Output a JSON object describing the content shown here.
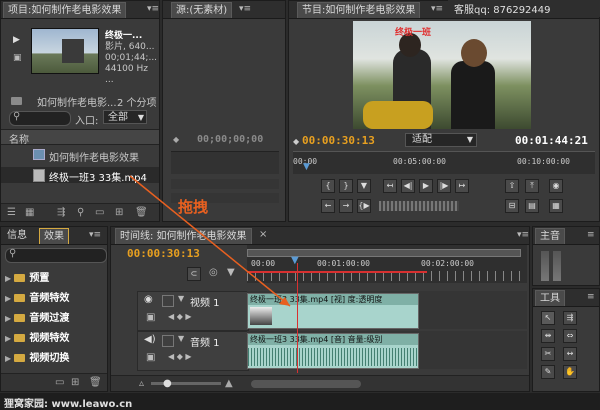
{
  "project": {
    "tab_label": "项目:如何制作老电影效果",
    "clip_name": "终极一...",
    "clip_type": "影片, 640...",
    "clip_duration": "00;01;44;...",
    "clip_audio": "44100 Hz ...",
    "bin_name": "如何制作老电影...",
    "item_count": "2 个分项",
    "search_placeholder": "",
    "entry_label": "入口:",
    "entry_value": "全部",
    "column_name": "名称",
    "items": [
      {
        "label": "如何制作老电影效果"
      },
      {
        "label": "终极一班3 33集.mp4"
      }
    ]
  },
  "source": {
    "tab_label": "源:(无素材)",
    "timecode": "00;00;00;00"
  },
  "program": {
    "tab_label": "节目:如何制作老电影效果",
    "video_caption": "终极一班",
    "current_time": "00:00:30:13",
    "fit_label": "适配",
    "duration": "00:01:44:21",
    "ruler": [
      "00:00",
      "00:05:00:00",
      "00:10:00:00"
    ]
  },
  "watermark": {
    "qq_label": "客服qq: 876292449",
    "drag_label": "拖拽",
    "footer_site": "狸窝家园: www.leawo.cn"
  },
  "effects": {
    "tabs": [
      "信息",
      "效果"
    ],
    "search_placeholder": "",
    "folders": [
      {
        "label": "预置"
      },
      {
        "label": "音频特效"
      },
      {
        "label": "音频过渡"
      },
      {
        "label": "视频特效"
      },
      {
        "label": "视频切换"
      }
    ]
  },
  "timeline": {
    "tab_label": "时间线: 如何制作老电影效果",
    "current_time": "00:00:30:13",
    "ruler": [
      "00:00",
      "00:01:00:00",
      "00:02:00:00"
    ],
    "video_track_name": "视频 1",
    "audio_track_name": "音频 1",
    "video_clip_label": "终极一班3 33集.mp4 [视] 度:透明度",
    "audio_clip_label": "终极一班3 33集.mp4 [音] 音量:级别"
  },
  "master": {
    "tab_label": "主音"
  },
  "tools": {
    "tab_label": "工具"
  },
  "colors": {
    "timecode": "#e8a020",
    "video_track": "#a8d4cc",
    "audio_track": "#a8d4cc",
    "playhead": "#d83030"
  }
}
